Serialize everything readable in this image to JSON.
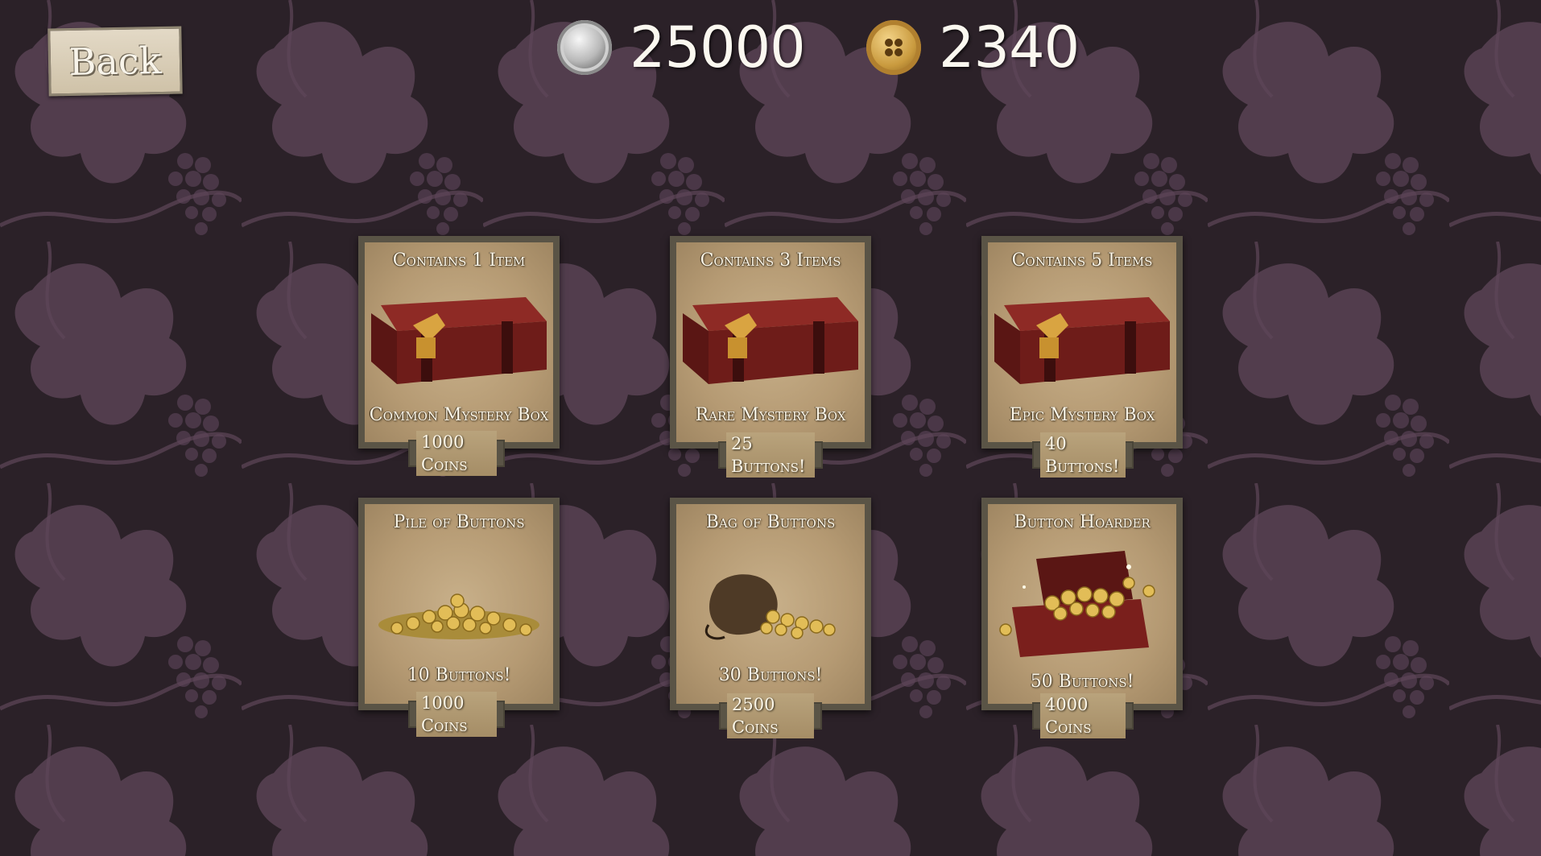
{
  "back_label": "Back",
  "currency": {
    "silver_icon": "silver-coin-icon",
    "silver_value": "25000",
    "button_icon": "gold-button-icon",
    "button_value": "2340"
  },
  "shop": [
    {
      "title": "Contains 1 Item",
      "name": "Common Mystery Box",
      "price": "1000 Coins",
      "icon": "red-chest-icon"
    },
    {
      "title": "Contains 3 Items",
      "name": "Rare Mystery Box",
      "price": "25 Buttons!",
      "icon": "red-chest-icon"
    },
    {
      "title": "Contains 5 Items",
      "name": "Epic Mystery Box",
      "price": "40 Buttons!",
      "icon": "red-chest-icon"
    },
    {
      "title": "Pile of Buttons",
      "name": "10 Buttons!",
      "price": "1000 Coins",
      "icon": "button-pile-icon"
    },
    {
      "title": "Bag of Buttons",
      "name": "30 Buttons!",
      "price": "2500 Coins",
      "icon": "button-bag-icon"
    },
    {
      "title": "Button Hoarder",
      "name": "50 Buttons!",
      "price": "4000 Coins",
      "icon": "treasure-chest-icon"
    }
  ],
  "colors": {
    "background": "#2a2027",
    "leaf": "#6e5468",
    "card_frame": "#5a5446",
    "parchment": "#b59a73",
    "chest_red": "#7a1f1c"
  }
}
